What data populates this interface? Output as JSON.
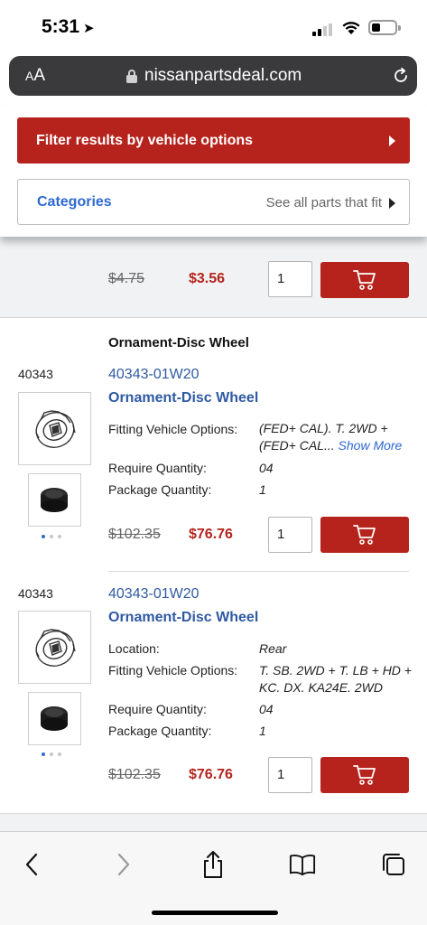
{
  "status_bar": {
    "time": "5:31",
    "location_icon": "location-arrow-icon"
  },
  "browser": {
    "text_size_label_big": "A",
    "text_size_label_small": "A",
    "url": "nissanpartsdeal.com",
    "lock_icon": "lock-icon",
    "reload_icon": "reload-icon"
  },
  "filters": {
    "filter_button_label": "Filter results by vehicle options",
    "categories_label": "Categories",
    "see_all_label": "See all parts that fit"
  },
  "previous_item": {
    "old_price": "$4.75",
    "new_price": "$3.56",
    "quantity": "1"
  },
  "group": {
    "title": "Ornament-Disc Wheel"
  },
  "parts": [
    {
      "ref": "40343",
      "part_number": "40343-01W20",
      "name": "Ornament-Disc Wheel",
      "specs": [
        {
          "label": "Fitting Vehicle Options:",
          "value": "(FED+ CAL). T. 2WD + (FED+ CAL...",
          "link": "Show More"
        },
        {
          "label": "Require Quantity:",
          "value": "04"
        },
        {
          "label": "Package Quantity:",
          "value": "1"
        }
      ],
      "old_price": "$102.35",
      "new_price": "$76.76",
      "quantity": "1"
    },
    {
      "ref": "40343",
      "part_number": "40343-01W20",
      "name": "Ornament-Disc Wheel",
      "specs": [
        {
          "label": "Location:",
          "value": "Rear"
        },
        {
          "label": "Fitting Vehicle Options:",
          "value": "T. SB. 2WD + T. LB + HD + KC. DX. KA24E. 2WD"
        },
        {
          "label": "Require Quantity:",
          "value": "04"
        },
        {
          "label": "Package Quantity:",
          "value": "1"
        }
      ],
      "old_price": "$102.35",
      "new_price": "$76.76",
      "quantity": "1"
    }
  ],
  "toolbar": {
    "icons": [
      "back-icon",
      "forward-icon",
      "share-icon",
      "bookmarks-icon",
      "tabs-icon"
    ]
  },
  "colors": {
    "accent_red": "#b5231c",
    "link_blue": "#2f5aa3",
    "categories_blue": "#2e6ad1"
  }
}
